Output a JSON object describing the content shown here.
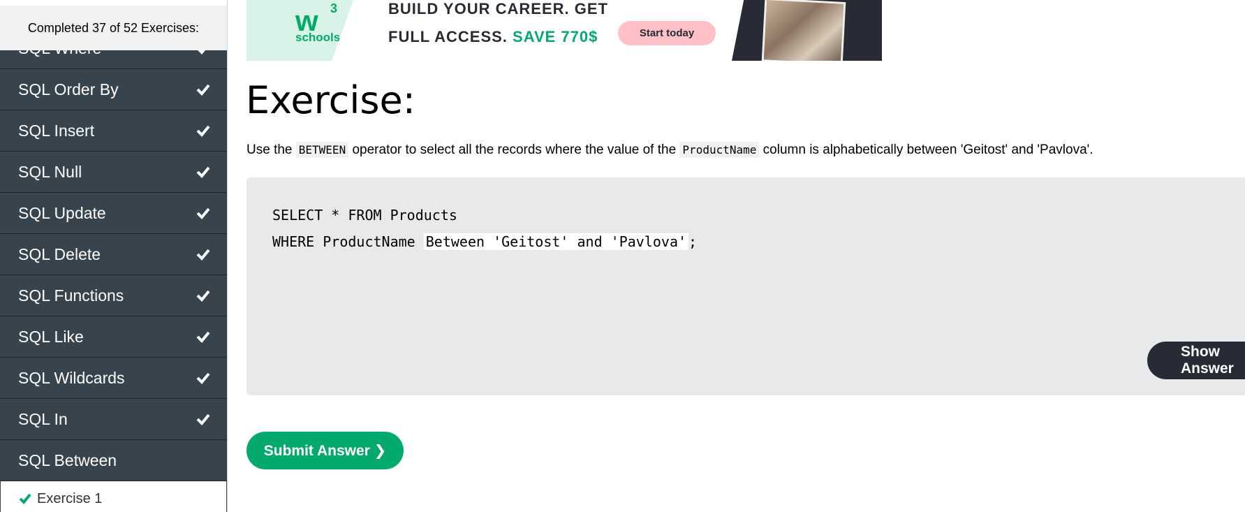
{
  "sidebar": {
    "progress_text": "Completed 37 of 52 Exercises:",
    "items": [
      {
        "label": "SQL Where"
      },
      {
        "label": "SQL Order By"
      },
      {
        "label": "SQL Insert"
      },
      {
        "label": "SQL Null"
      },
      {
        "label": "SQL Update"
      },
      {
        "label": "SQL Delete"
      },
      {
        "label": "SQL Functions"
      },
      {
        "label": "SQL Like"
      },
      {
        "label": "SQL Wildcards"
      },
      {
        "label": "SQL In"
      },
      {
        "label": "SQL Between"
      }
    ],
    "sub_items": [
      {
        "label": "Exercise 1"
      }
    ]
  },
  "banner": {
    "logo_w": "w",
    "logo_3": "3",
    "logo_schools": "schools",
    "line1": "BUILD YOUR CAREER. GET",
    "line2_prefix": "FULL ACCESS.",
    "line2_save": "SAVE 770$",
    "button": "Start today"
  },
  "exercise": {
    "title": "Exercise:",
    "instr_1": "Use the",
    "instr_code1": "BETWEEN",
    "instr_2": "operator to select all the records where the value of the",
    "instr_code2": "ProductName",
    "instr_3": "column is alphabetically between 'Geitost' and 'Pavlova'.",
    "code_line1": "SELECT * FROM Products",
    "code_line2_prefix": "WHERE ProductName ",
    "code_input_value": "Between 'Geitost' and 'Pavlova'",
    "code_line2_suffix": ";",
    "show_answer": "Show Answer",
    "submit": "Submit Answer ❯"
  },
  "colors": {
    "sidebar_bg": "#38444d",
    "accent": "#04aa6d",
    "dark": "#282a35",
    "code_bg": "#e7e9eb"
  }
}
